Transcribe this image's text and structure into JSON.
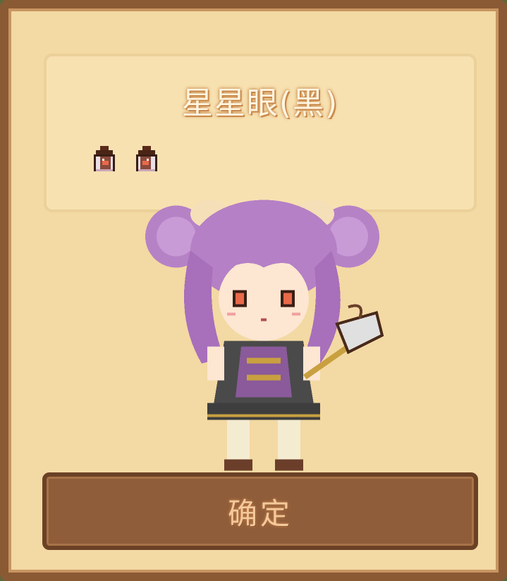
{
  "dialog": {
    "item_name": "星星眼(黑)",
    "confirm_label": "确定"
  },
  "icons": {
    "eye_left": "eye-icon",
    "eye_right": "eye-icon",
    "character": "character-sprite"
  },
  "colors": {
    "frame": "#8a5a34",
    "panel_bg": "#f3d9a3",
    "info_bg": "#f7e1b1",
    "button_bg": "#8f5d3a",
    "button_text": "#f4c99c",
    "hair": "#b07cc0"
  }
}
